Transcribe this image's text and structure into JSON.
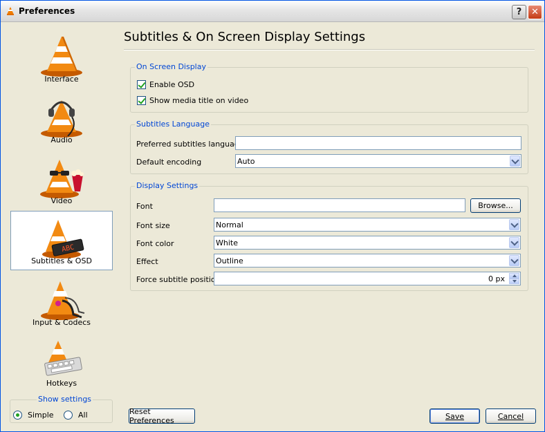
{
  "window": {
    "title": "Preferences",
    "help_label": "?",
    "close_label": "✕"
  },
  "sidebar": {
    "items": [
      {
        "label": "Interface",
        "icon": "vlc-cone-icon"
      },
      {
        "label": "Audio",
        "icon": "vlc-cone-headphones-icon"
      },
      {
        "label": "Video",
        "icon": "vlc-cone-glasses-popcorn-icon"
      },
      {
        "label": "Subtitles & OSD",
        "icon": "vlc-cone-subtitles-icon",
        "selected": true
      },
      {
        "label": "Input & Codecs",
        "icon": "vlc-cone-cables-icon"
      },
      {
        "label": "Hotkeys",
        "icon": "vlc-cone-keyboard-icon"
      }
    ]
  },
  "show_settings": {
    "legend": "Show settings",
    "simple_label": "Simple",
    "all_label": "All",
    "selected": "Simple"
  },
  "page": {
    "title": "Subtitles & On Screen Display Settings"
  },
  "osd": {
    "legend": "On Screen Display",
    "enable_osd": {
      "label": "Enable OSD",
      "checked": true
    },
    "show_title": {
      "label": "Show media title on video",
      "checked": true
    }
  },
  "subs_lang": {
    "legend": "Subtitles Language",
    "preferred_label": "Preferred subtitles language",
    "preferred_value": "",
    "encoding_label": "Default encoding",
    "encoding_value": "Auto"
  },
  "display": {
    "legend": "Display Settings",
    "font_label": "Font",
    "font_value": "",
    "browse_label": "Browse...",
    "font_size_label": "Font size",
    "font_size_value": "Normal",
    "font_color_label": "Font color",
    "font_color_value": "White",
    "effect_label": "Effect",
    "effect_value": "Outline",
    "position_label": "Force subtitle position",
    "position_value": "0 px"
  },
  "buttons": {
    "reset": "Reset Preferences",
    "save": "Save",
    "cancel": "Cancel"
  },
  "colors": {
    "accent": "#0046d5",
    "cone_orange": "#f07c00",
    "window_bg": "#ece9d8"
  }
}
